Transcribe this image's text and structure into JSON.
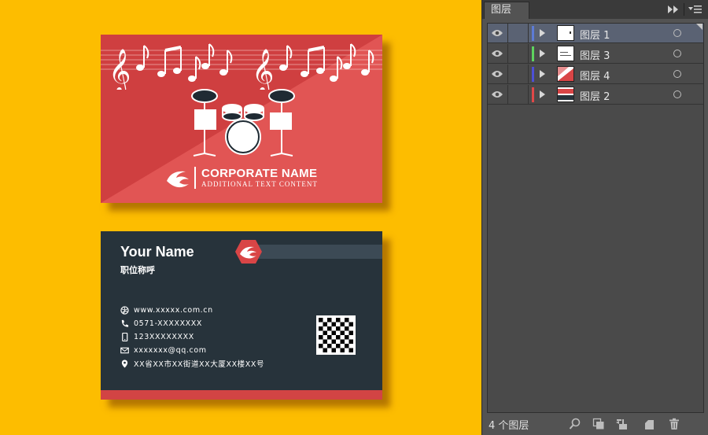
{
  "front": {
    "corporate_name": "CORPORATE NAME",
    "tagline": "ADDITIONAL TEXT CONTENT"
  },
  "back": {
    "name": "Your Name",
    "title": "职位称呼",
    "website": "www.xxxxx.com.cn",
    "phone": "0571-XXXXXXXX",
    "mobile": "123XXXXXXXX",
    "email": "xxxxxxx@qq.com",
    "address": "XX省XX市XX街道XX大厦XX楼XX号"
  },
  "panel": {
    "tab": "图层",
    "layers": [
      {
        "label": "图层 1",
        "color": "#5d7bd6",
        "selected": true
      },
      {
        "label": "图层 3",
        "color": "#5ed35e",
        "selected": false
      },
      {
        "label": "图层 4",
        "color": "#4d50d6",
        "selected": false
      },
      {
        "label": "图层 2",
        "color": "#e04848",
        "selected": false
      }
    ],
    "count": "4 个图层"
  },
  "colors": {
    "background": "#fdbd00",
    "card_red": "#d24444",
    "card_dark": "#27333b"
  }
}
